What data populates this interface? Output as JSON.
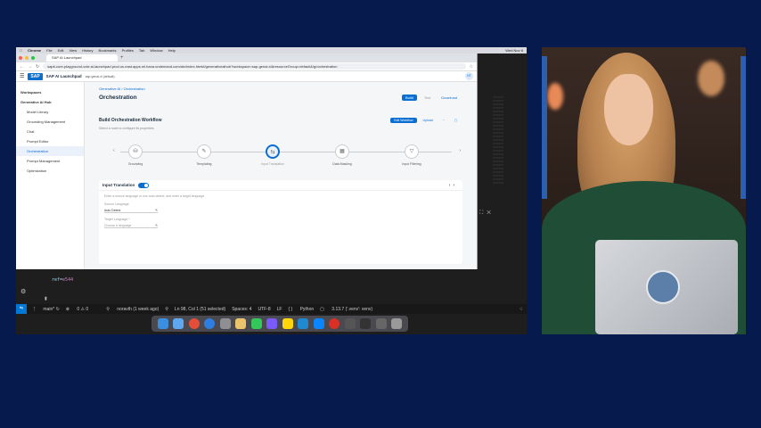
{
  "menubar": {
    "app": "Chrome",
    "items": [
      "File",
      "Edit",
      "View",
      "History",
      "Bookmarks",
      "Profiles",
      "Tab",
      "Window",
      "Help"
    ],
    "clock": "Wed Nov 6"
  },
  "browser": {
    "tab_title": "SAP AI Launchpad",
    "url": "sapit-core-playground-vole.ai-launchpad.prod.us-east.apps.ml.hana.ondemand.com/aic/index.html#/generativeaihub?workspace=sap-genai-xl&resourceGroup=default&/g/orchestration"
  },
  "shell": {
    "brand": "SAP",
    "product": "SAP AI Launchpad",
    "context": "sap-genai-xl (default)",
    "avatar": "NT"
  },
  "sidebar": {
    "items": [
      {
        "label": "Workspaces",
        "group": true
      },
      {
        "label": "Generative AI Hub",
        "group": true
      },
      {
        "label": "Model Library"
      },
      {
        "label": "Grounding Management"
      },
      {
        "label": "Chat"
      },
      {
        "label": "Prompt Editor"
      },
      {
        "label": "Orchestration",
        "active": true
      },
      {
        "label": "Prompt Management"
      },
      {
        "label": "Optimization"
      }
    ]
  },
  "main": {
    "breadcrumb": "Generative AI  /  Orchestration",
    "title": "Orchestration",
    "buttons": {
      "build": "Build",
      "test": "Test",
      "download": "Download"
    },
    "workflow": {
      "title": "Build Orchestration Workflow",
      "subtitle": "Select a node to configure its properties",
      "buttons": {
        "edit": "Edit Workflow",
        "upload": "Upload"
      },
      "nodes": [
        {
          "label": "Grounding",
          "icon": "database-icon"
        },
        {
          "label": "Templating",
          "icon": "edit-icon"
        },
        {
          "label": "Input Translation",
          "icon": "translate-icon",
          "active": true
        },
        {
          "label": "Data Masking",
          "icon": "mask-icon"
        },
        {
          "label": "Input Filtering",
          "icon": "filter-icon"
        }
      ]
    },
    "panel": {
      "title": "Input Translation",
      "hint": "Enter a source language or use auto-detect, and enter a target language.",
      "source_label": "Source Language",
      "source_value": "Auto Detect",
      "target_label": "Target Language *",
      "target_placeholder": "Choose a language"
    }
  },
  "editor": {
    "code_key": "ref=",
    "code_value": "e544"
  },
  "statusbar": {
    "branch": "main*",
    "problems": "0 ⚠ 0",
    "blame": "noravth (1 week ago)",
    "cursor": "Ln 98, Col 1 (51 selected)",
    "spaces": "Spaces: 4",
    "encoding": "UTF-8",
    "eol": "LF",
    "language": "Python",
    "interpreter": "3.13.7 ('.venv': venv)"
  },
  "colors": {
    "background": "#071a4e",
    "accent": "#0a6ed1",
    "sweater": "#1f4d36"
  }
}
